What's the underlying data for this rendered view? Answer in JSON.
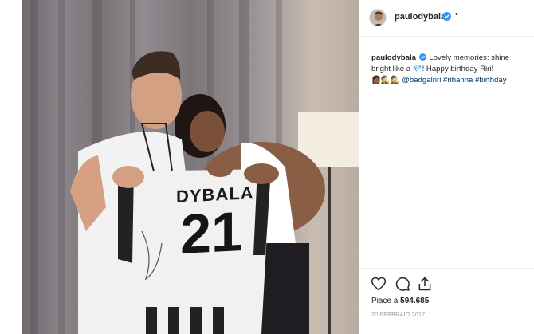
{
  "header": {
    "username": "paulodybala",
    "more_dot": "•"
  },
  "caption": {
    "username": "paulodybala",
    "text_1": " Lovely memories: shine bright like a ",
    "emoji_diamond": "💎",
    "text_2": "! Happy birthday Riri! ",
    "emoji_group": "👩🏾🕵️🕵️",
    "mention": "@badgalriri",
    "hashtag_1": "#rihanna",
    "hashtag_2": "#birthday"
  },
  "photo": {
    "jersey_name": "DYBALA",
    "jersey_number": "21"
  },
  "likes": {
    "prefix": "Piace a ",
    "count": "594.685"
  },
  "date": "20 FEBBRAIO 2017",
  "icons": {
    "verified": "verified-badge-icon",
    "like": "heart-icon",
    "comment": "comment-bubble-icon",
    "share": "share-icon"
  },
  "colors": {
    "verified_blue": "#3897f0",
    "link_blue": "#003569",
    "text": "#262626",
    "muted": "#999999"
  }
}
